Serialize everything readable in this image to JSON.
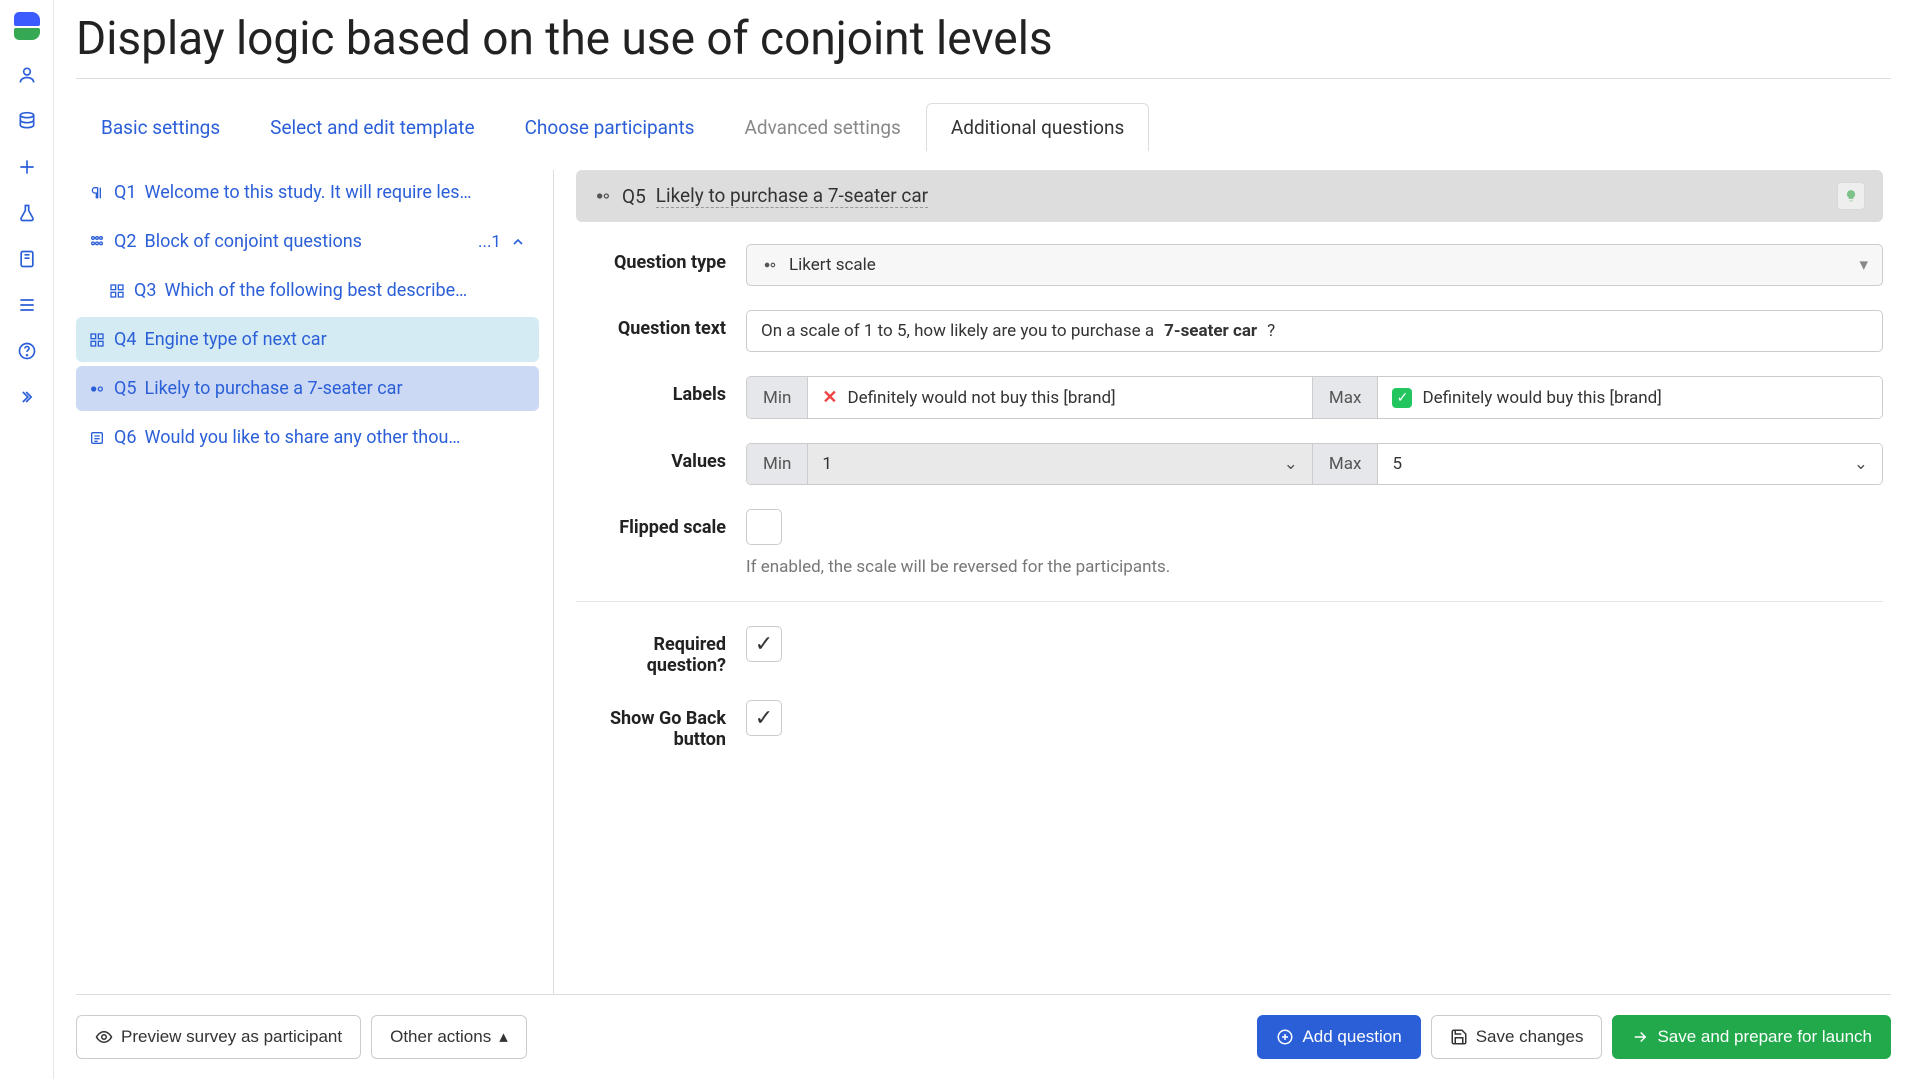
{
  "page": {
    "title": "Display logic based on the use of conjoint levels"
  },
  "tabs": [
    {
      "label": "Basic settings",
      "key": "basic"
    },
    {
      "label": "Select and edit template",
      "key": "template"
    },
    {
      "label": "Choose participants",
      "key": "participants"
    },
    {
      "label": "Advanced settings",
      "key": "advanced",
      "muted": true
    },
    {
      "label": "Additional questions",
      "key": "additional",
      "active": true
    }
  ],
  "questions": [
    {
      "code": "Q1",
      "label": "Welcome to this study. It will require les…",
      "icon": "paragraph"
    },
    {
      "code": "Q2",
      "label": "Block of conjoint questions",
      "icon": "block",
      "badge": "...1",
      "expandable": true
    },
    {
      "code": "Q3",
      "label": "Which of the following best describe…",
      "icon": "grid",
      "indent": true
    },
    {
      "code": "Q4",
      "label": "Engine type of next car",
      "icon": "grid",
      "highlight": "engine"
    },
    {
      "code": "Q5",
      "label": "Likely to purchase a 7-seater car",
      "icon": "likert",
      "selected": true
    },
    {
      "code": "Q6",
      "label": "Would you like to share any other thou…",
      "icon": "text"
    }
  ],
  "editor": {
    "header_code": "Q5",
    "header_title": "Likely to purchase a 7-seater car",
    "question_type_label": "Question type",
    "question_type_value": "Likert scale",
    "question_text_label": "Question text",
    "question_text_prefix": "On a scale of 1 to 5, how likely are you to purchase a ",
    "question_text_bold": "7-seater car",
    "question_text_suffix": "?",
    "labels_label": "Labels",
    "labels_min_tag": "Min",
    "labels_min_value": "Definitely would not buy this [brand]",
    "labels_max_tag": "Max",
    "labels_max_value": "Definitely would buy this [brand]",
    "values_label": "Values",
    "values_min_tag": "Min",
    "values_min_value": "1",
    "values_max_tag": "Max",
    "values_max_value": "5",
    "flipped_label": "Flipped scale",
    "flipped_help": "If enabled, the scale will be reversed for the participants.",
    "required_label": "Required question?",
    "goback_label": "Show Go Back button"
  },
  "footer": {
    "preview": "Preview survey as participant",
    "other": "Other actions",
    "add": "Add question",
    "save": "Save changes",
    "launch": "Save and prepare for launch"
  }
}
